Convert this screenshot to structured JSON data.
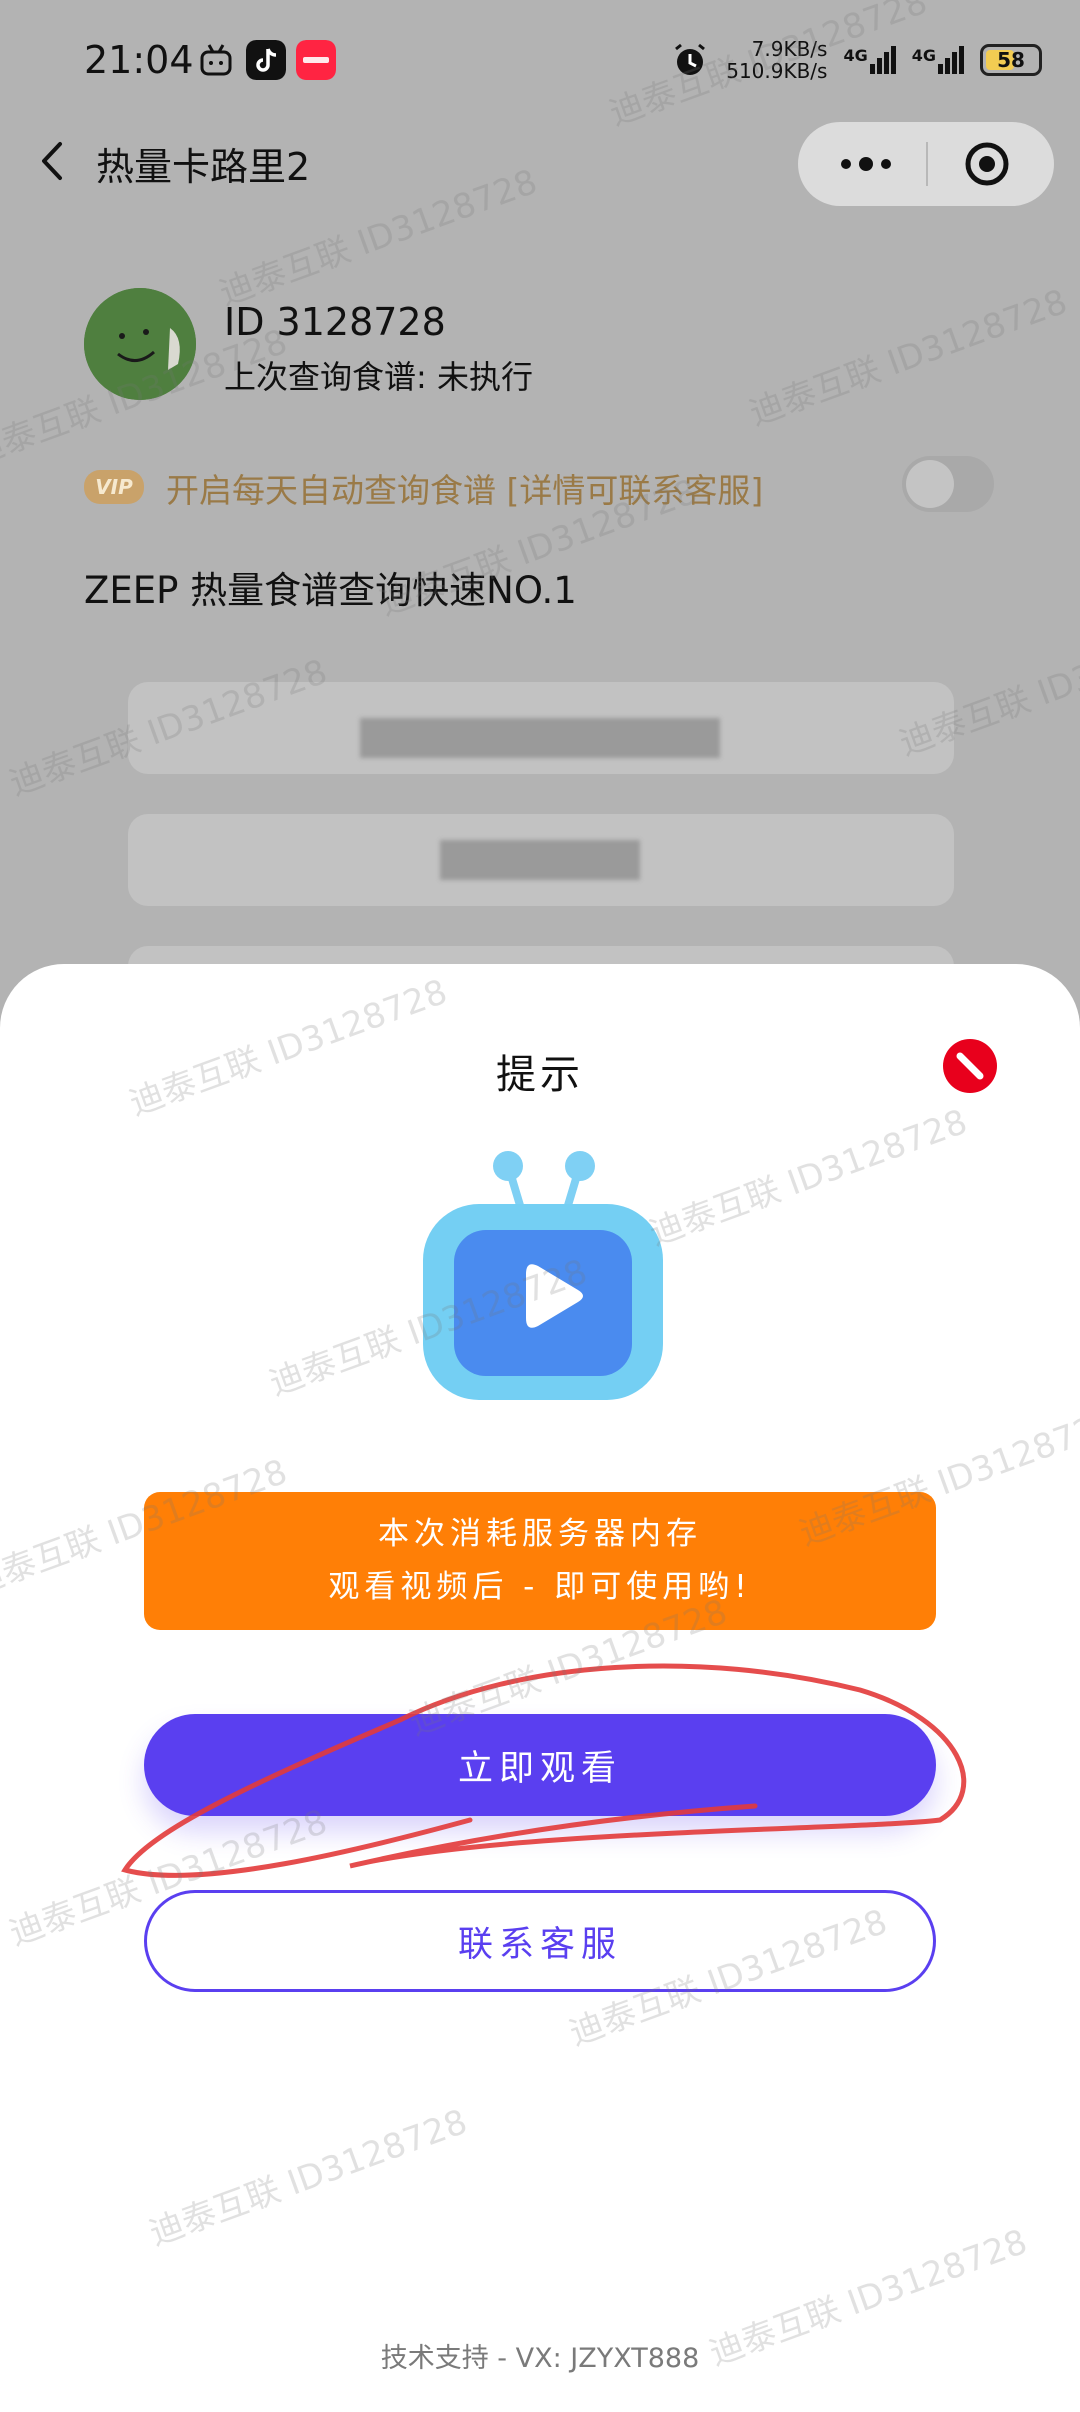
{
  "status_bar": {
    "time": "21:04",
    "net_up": "7.9KB/s",
    "net_down": "510.9KB/s",
    "signal1": "4G",
    "signal2": "4G",
    "battery": "58"
  },
  "nav": {
    "title": "热量卡路里2"
  },
  "profile": {
    "id": "ID 3128728",
    "last_query": "上次查询食谱: 未执行"
  },
  "vip": {
    "badge": "VIP",
    "text": "开启每天自动查询食谱 [详情可联系客服]",
    "enabled": false
  },
  "section_title": "ZEEP 热量食谱查询快速NO.1",
  "dialog": {
    "title": "提示",
    "notice_line1": "本次消耗服务器内存",
    "notice_line2": "观看视频后 - 即可使用哟!",
    "watch_button": "立即观看",
    "service_button": "联系客服",
    "footer": "技术支持 - VX: JZYXT888"
  },
  "watermark": "迪泰互联 ID3128728",
  "colors": {
    "accent": "#5a3ff0",
    "notice": "#ff7f06",
    "close": "#e8001c",
    "vip_text": "#9a7a47"
  }
}
